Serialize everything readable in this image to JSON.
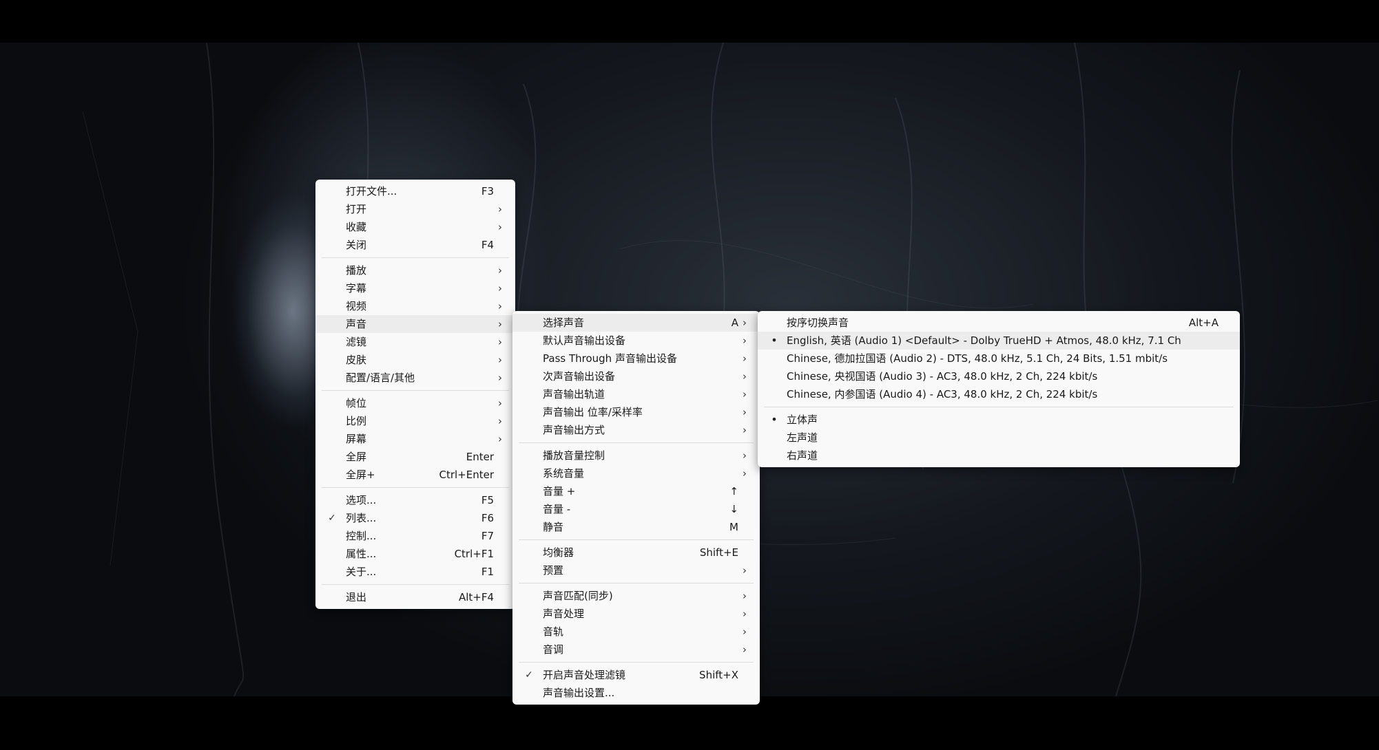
{
  "main_menu": {
    "groups": [
      [
        {
          "label": "打开文件...",
          "shortcut": "F3"
        },
        {
          "label": "打开",
          "submenu": true
        },
        {
          "label": "收藏",
          "submenu": true
        },
        {
          "label": "关闭",
          "shortcut": "F4"
        }
      ],
      [
        {
          "label": "播放",
          "submenu": true
        },
        {
          "label": "字幕",
          "submenu": true
        },
        {
          "label": "视频",
          "submenu": true
        },
        {
          "label": "声音",
          "submenu": true,
          "highlighted": true
        },
        {
          "label": "滤镜",
          "submenu": true
        },
        {
          "label": "皮肤",
          "submenu": true
        },
        {
          "label": "配置/语言/其他",
          "submenu": true
        }
      ],
      [
        {
          "label": "帧位",
          "submenu": true
        },
        {
          "label": "比例",
          "submenu": true
        },
        {
          "label": "屏幕",
          "submenu": true
        },
        {
          "label": "全屏",
          "shortcut": "Enter"
        },
        {
          "label": "全屏+",
          "shortcut": "Ctrl+Enter"
        }
      ],
      [
        {
          "label": "选项...",
          "shortcut": "F5"
        },
        {
          "label": "列表...",
          "shortcut": "F6",
          "checked": true
        },
        {
          "label": "控制...",
          "shortcut": "F7"
        },
        {
          "label": "属性...",
          "shortcut": "Ctrl+F1"
        },
        {
          "label": "关于...",
          "shortcut": "F1"
        }
      ],
      [
        {
          "label": "退出",
          "shortcut": "Alt+F4"
        }
      ]
    ]
  },
  "audio_menu": {
    "groups": [
      [
        {
          "label": "选择声音",
          "shortcut": "A",
          "submenu": true,
          "highlighted": true
        },
        {
          "label": "默认声音输出设备",
          "submenu": true
        },
        {
          "label": "Pass Through 声音输出设备",
          "submenu": true
        },
        {
          "label": "次声音输出设备",
          "submenu": true
        },
        {
          "label": "声音输出轨道",
          "submenu": true
        },
        {
          "label": "声音输出 位率/采样率",
          "submenu": true
        },
        {
          "label": "声音输出方式",
          "submenu": true
        }
      ],
      [
        {
          "label": "播放音量控制",
          "submenu": true
        },
        {
          "label": "系统音量",
          "submenu": true
        },
        {
          "label": "音量 +",
          "shortcut": "↑"
        },
        {
          "label": "音量 -",
          "shortcut": "↓"
        },
        {
          "label": "静音",
          "shortcut": "M"
        }
      ],
      [
        {
          "label": "均衡器",
          "shortcut": "Shift+E"
        },
        {
          "label": "预置",
          "submenu": true
        }
      ],
      [
        {
          "label": "声音匹配(同步)",
          "submenu": true
        },
        {
          "label": "声音处理",
          "submenu": true
        },
        {
          "label": "音轨",
          "submenu": true
        },
        {
          "label": "音调",
          "submenu": true
        }
      ],
      [
        {
          "label": "开启声音处理滤镜",
          "shortcut": "Shift+X",
          "checked": true
        },
        {
          "label": "声音输出设置..."
        }
      ]
    ]
  },
  "track_menu": {
    "groups": [
      [
        {
          "label": "按序切换声音",
          "shortcut": "Alt+A"
        },
        {
          "label": "English, 英语 (Audio 1) <Default> - Dolby TrueHD + Atmos, 48.0 kHz, 7.1 Ch",
          "selected": true,
          "highlighted": true
        },
        {
          "label": "Chinese, 德加拉国语 (Audio 2) - DTS, 48.0 kHz, 5.1 Ch, 24 Bits, 1.51 mbit/s"
        },
        {
          "label": "Chinese, 央视国语 (Audio 3) - AC3, 48.0 kHz, 2 Ch, 224 kbit/s"
        },
        {
          "label": "Chinese, 内参国语 (Audio 4) - AC3, 48.0 kHz, 2 Ch, 224 kbit/s"
        }
      ],
      [
        {
          "label": "立体声",
          "selected": true
        },
        {
          "label": "左声道"
        },
        {
          "label": "右声道"
        }
      ]
    ]
  },
  "glyphs": {
    "check": "✓",
    "bullet": "•",
    "arrow": "›"
  },
  "colors": {
    "menu_bg": "#f9f9f9",
    "highlight": "#ececec",
    "separator": "#dcdcdc",
    "text": "#1a1a1a"
  }
}
